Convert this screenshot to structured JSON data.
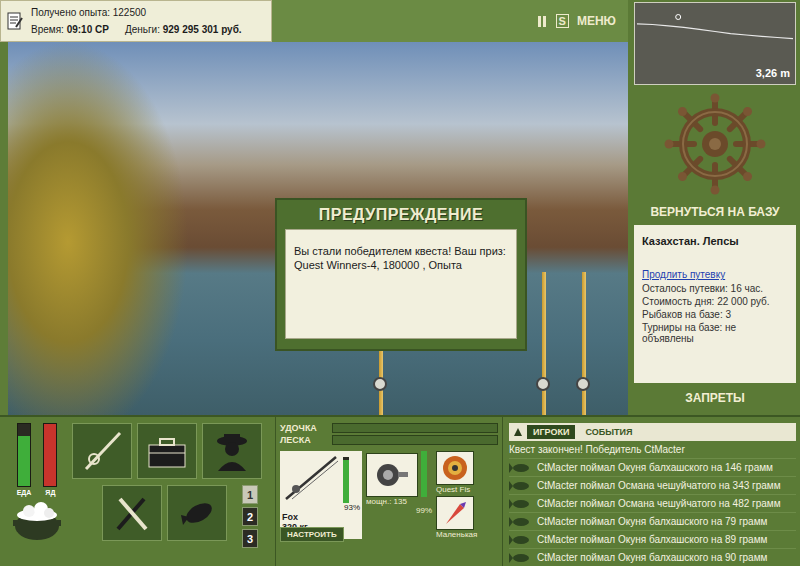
{
  "stats": {
    "experience": "Получено опыта: 122500",
    "time_label": "Время:",
    "time": "09:10 СР",
    "money_label": "Деньги:",
    "money": "929 295 301 руб."
  },
  "top_buttons": {
    "sound": "S",
    "menu": "МЕНЮ"
  },
  "depth": {
    "reading": "3,26 m",
    "profile": [
      2.2,
      2.25,
      2.35,
      2.45,
      2.6,
      2.75,
      2.9,
      3.0,
      3.1,
      3.18,
      3.26
    ],
    "float_position": 0.27
  },
  "scene": {
    "rod_count": 3
  },
  "dialog": {
    "title": "ПРЕДУПРЕЖДЕНИЕ",
    "message": "Вы стали победителем квеста! Ваш приз: Quest Winners-4, 180000 , Опыта"
  },
  "base": {
    "button": "ВЕРНУТЬСЯ НА БАЗУ",
    "location": "Казахстан. Лепсы",
    "link": "Продлить путевку",
    "lines": [
      "Осталось путевки: 16 час.",
      "Стоимость дня: 22 000 руб.",
      "Рыбаков на базе: 3",
      "Турниры на базе: не объявлены"
    ],
    "bans": "ЗАПРЕТЫ"
  },
  "meters": [
    {
      "label": "ЕДА",
      "level": 0.8,
      "color": "#3fae3a"
    },
    {
      "label": "ЯД",
      "level": 1.0,
      "color": "#c8342c"
    }
  ],
  "slots": [
    {
      "label": "1",
      "selected": true
    },
    {
      "label": "2",
      "selected": false
    },
    {
      "label": "3",
      "selected": false
    }
  ],
  "gear_bars": [
    {
      "label": "УДОЧКА",
      "level": 0
    },
    {
      "label": "ЛЕСКА",
      "level": 0
    }
  ],
  "tackle": {
    "rod": {
      "condition": "93%",
      "level": 0.93,
      "name": "Fox",
      "capacity": "320 кг",
      "button": "НАСТРОИТЬ"
    },
    "reel": {
      "power": "мощн.: 135",
      "condition": "99%",
      "level": 0.99
    },
    "line": {
      "name": "Quest Fis"
    },
    "lure": {
      "name": "Маленькая"
    }
  },
  "log": {
    "tabs": [
      {
        "label": "ИГРОКИ",
        "selected": true
      },
      {
        "label": "СОБЫТИЯ",
        "selected": false
      }
    ],
    "entries": [
      {
        "kind": "notice",
        "text": "Квест закончен! Победитель CtMacter"
      },
      {
        "kind": "catch",
        "text": "CtMacter поймал Окуня балхашского на 146 грамм"
      },
      {
        "kind": "catch",
        "text": "CtMacter поймал Османа чешуйчатого на 343 грамм"
      },
      {
        "kind": "catch",
        "text": "CtMacter поймал Османа чешуйчатого на 482 грамм"
      },
      {
        "kind": "catch",
        "text": "CtMacter поймал Окуня балхашского на 79 грамм"
      },
      {
        "kind": "catch",
        "text": "CtMacter поймал Окуня балхашского на 89 грамм"
      },
      {
        "kind": "catch",
        "text": "CtMacter поймал Окуня балхашского на 90 грамм"
      }
    ]
  }
}
